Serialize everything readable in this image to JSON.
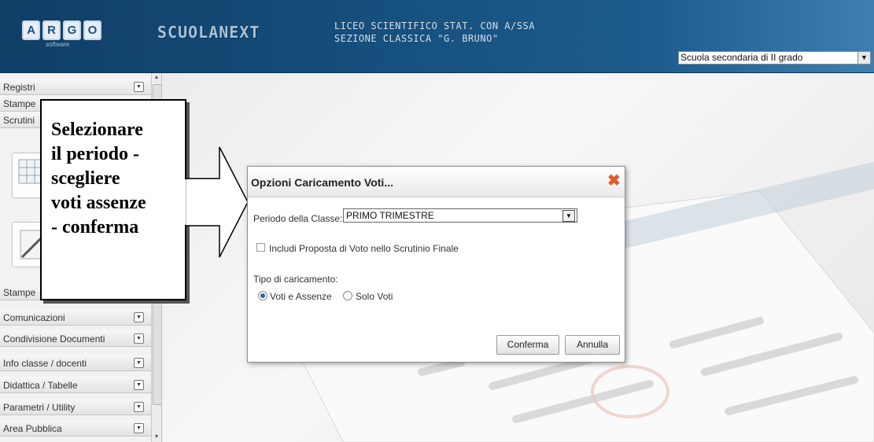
{
  "header": {
    "logo_letters": [
      "A",
      "R",
      "G",
      "O"
    ],
    "logo_sub": "software",
    "app_name": "SCUOLANEXT",
    "school_line1": "LICEO SCIENTIFICO STAT. CON A/SSA",
    "school_line2": "SEZIONE CLASSICA \"G. BRUNO\"",
    "school_level_select": {
      "value": "Scuola secondaria di II grado",
      "icon": "chevron-down-icon"
    },
    "colors": {
      "gradient_start": "#0f3e66",
      "gradient_end": "#3f7fb0"
    }
  },
  "sidebar": {
    "items": [
      {
        "label": "Registri",
        "icon": "collapse-toggle-icon"
      },
      {
        "label": "Stampe"
      },
      {
        "label": "Scrutini"
      },
      {
        "label": "Stampe"
      },
      {
        "label": "Comunicazioni",
        "icon": "collapse-toggle-icon"
      },
      {
        "label": "Condivisione Documenti",
        "icon": "collapse-toggle-icon"
      },
      {
        "label": "Info classe / docenti",
        "icon": "collapse-toggle-icon"
      },
      {
        "label": "Didattica / Tabelle",
        "icon": "collapse-toggle-icon"
      },
      {
        "label": "Parametri / Utility",
        "icon": "collapse-toggle-icon"
      },
      {
        "label": "Area Pubblica",
        "icon": "collapse-toggle-icon"
      }
    ]
  },
  "callout": {
    "text": "Selezionare\nil periodo -\nscegliere\nvoti  assenze\n- conferma"
  },
  "dialog": {
    "title": "Opzioni Caricamento Voti...",
    "close_icon": "close-icon",
    "close_color": "#e15a2a",
    "period_label": "Periodo della Classe:",
    "period_value": "PRIMO TRIMESTRE",
    "include_label": "Includi Proposta di Voto nello Scrutinio Finale",
    "include_checked": false,
    "load_type_label": "Tipo di caricamento:",
    "radio_options": [
      {
        "label": "Voti e Assenze",
        "checked": true
      },
      {
        "label": "Solo Voti",
        "checked": false
      }
    ],
    "confirm_label": "Conferma",
    "cancel_label": "Annulla"
  }
}
